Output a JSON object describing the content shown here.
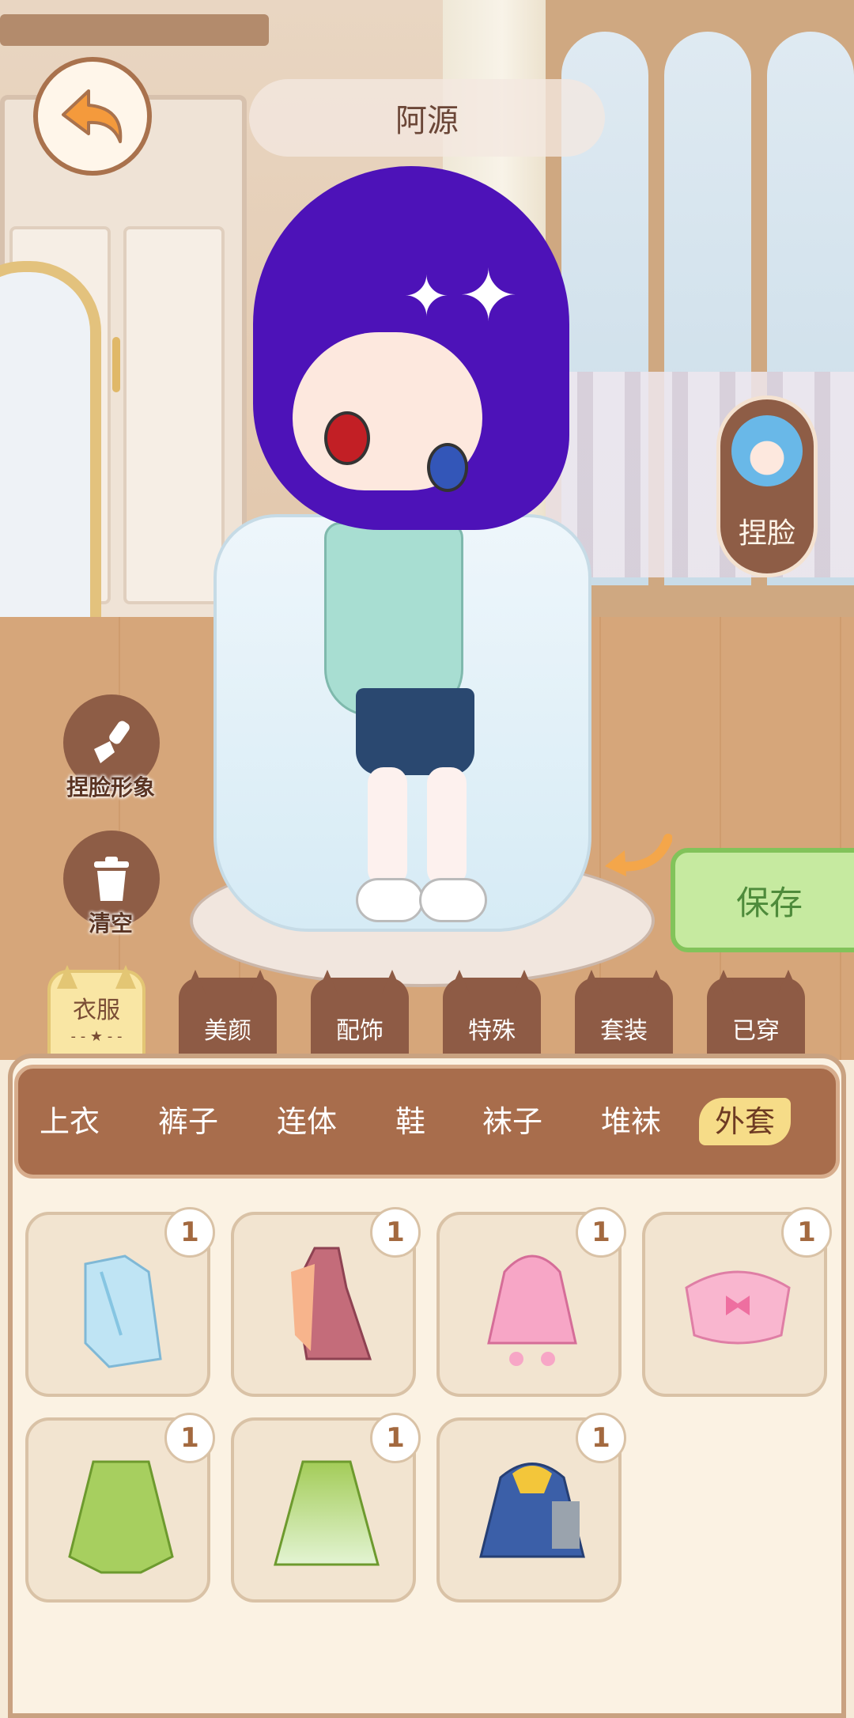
{
  "header": {
    "character_name": "阿源"
  },
  "side_buttons": {
    "face_button_label": "捏脸",
    "edit_face_label": "捏脸形象",
    "clear_label": "清空",
    "save_label": "保存"
  },
  "category_tabs": [
    {
      "label": "衣服",
      "active": true
    },
    {
      "label": "美颜",
      "active": false
    },
    {
      "label": "配饰",
      "active": false
    },
    {
      "label": "特殊",
      "active": false
    },
    {
      "label": "套装",
      "active": false
    },
    {
      "label": "已穿",
      "active": false
    }
  ],
  "sub_tabs": [
    {
      "label": "上衣",
      "active": false
    },
    {
      "label": "裤子",
      "active": false
    },
    {
      "label": "连体",
      "active": false
    },
    {
      "label": "鞋",
      "active": false
    },
    {
      "label": "袜子",
      "active": false
    },
    {
      "label": "堆袜",
      "active": false
    },
    {
      "label": "外套",
      "active": true
    }
  ],
  "items": [
    {
      "icon": "blue-crystal-coat-icon",
      "count": "1"
    },
    {
      "icon": "rose-gown-coat-icon",
      "count": "1"
    },
    {
      "icon": "pink-hooded-jacket-icon",
      "count": "1"
    },
    {
      "icon": "pink-bow-cape-icon",
      "count": "1"
    },
    {
      "icon": "green-robe-icon",
      "count": "1"
    },
    {
      "icon": "green-gradient-robe-icon",
      "count": "1"
    },
    {
      "icon": "blue-yellow-hoodie-icon",
      "count": "1"
    }
  ],
  "colors": {
    "brown": "#8e5b45",
    "panel": "#fbf2e3",
    "active_tab": "#f9e6a4",
    "save_green": "#c6eaa0"
  }
}
